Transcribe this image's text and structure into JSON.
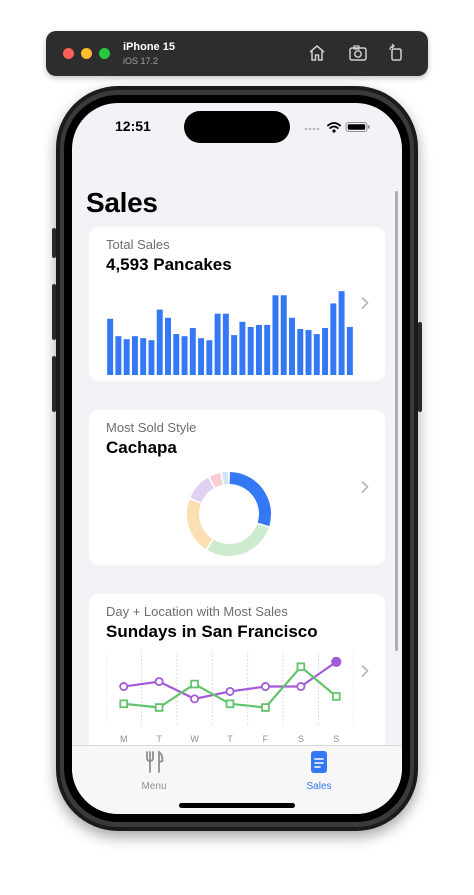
{
  "simulator": {
    "device_name": "iPhone 15",
    "os_version": "iOS 17.2",
    "icons": [
      "home-icon",
      "screenshot-icon",
      "rotate-icon"
    ]
  },
  "status_bar": {
    "time": "12:51"
  },
  "nav": {
    "title": "Sales"
  },
  "cards": {
    "total_sales": {
      "label": "Total Sales",
      "value": "4,593 Pancakes"
    },
    "most_sold": {
      "label": "Most Sold Style",
      "value": "Cachapa"
    },
    "best_day": {
      "label": "Day + Location with Most Sales",
      "value": "Sundays in San Francisco"
    }
  },
  "chart_data": [
    {
      "type": "bar",
      "values": [
        55,
        38,
        35,
        38,
        36,
        34,
        64,
        56,
        40,
        38,
        46,
        36,
        34,
        60,
        60,
        39,
        52,
        47,
        49,
        49,
        78,
        78,
        56,
        45,
        44,
        40,
        46,
        70,
        82,
        47
      ],
      "ylim": [
        0,
        90
      ],
      "color": "#3478f6"
    },
    {
      "type": "pie",
      "style": "donut",
      "slices": [
        {
          "value": 30,
          "color": "#3478f6"
        },
        {
          "value": 29,
          "color": "#cdeccf"
        },
        {
          "value": 22,
          "color": "#fbdfb3"
        },
        {
          "value": 11,
          "color": "#e0d0f1"
        },
        {
          "value": 5,
          "color": "#f7cdd1"
        },
        {
          "value": 3,
          "color": "#cce5f4"
        }
      ]
    },
    {
      "type": "line",
      "categories": [
        "M",
        "T",
        "W",
        "T",
        "F",
        "S",
        "S"
      ],
      "series": [
        {
          "color": "#a35ad6",
          "marker": "circle",
          "values": [
            52,
            56,
            42,
            48,
            52,
            52,
            72
          ]
        },
        {
          "color": "#62c36a",
          "marker": "square",
          "values": [
            38,
            35,
            54,
            38,
            35,
            68,
            44
          ]
        }
      ],
      "ylim": [
        20,
        80
      ]
    }
  ],
  "tabbar": {
    "items": [
      {
        "label": "Menu",
        "icon": "fork-knife-icon",
        "selected": false
      },
      {
        "label": "Sales",
        "icon": "document-icon",
        "selected": true
      }
    ],
    "active_color": "#3478f6",
    "inactive_color": "#8e8e93"
  }
}
